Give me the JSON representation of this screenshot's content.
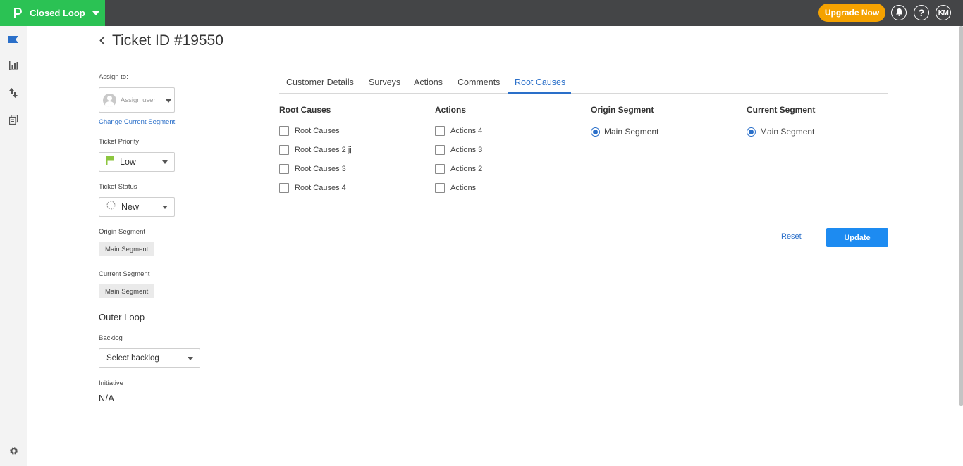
{
  "app": {
    "name": "Closed Loop"
  },
  "topbar": {
    "upgrade_label": "Upgrade Now",
    "help_label": "?",
    "user_initials": "KM"
  },
  "colors": {
    "brand": "#2bc254",
    "topbar": "#444547",
    "accent": "#2a6fc9",
    "upgrade": "#f5a200",
    "update": "#1d8bf1",
    "priority_flag": "#8dc63f"
  },
  "rail": {
    "icons": [
      "flag-icon",
      "bar-chart-icon",
      "sort-arrows-icon",
      "documents-icon",
      "gear-icon"
    ]
  },
  "page": {
    "title": "Ticket ID #19550"
  },
  "left_panel": {
    "assign_label": "Assign to:",
    "assign_placeholder": "Assign user",
    "change_segment_link": "Change Current Segment",
    "priority_label": "Ticket Priority",
    "priority_value": "Low",
    "status_label": "Ticket Status",
    "status_value": "New",
    "origin_segment_label": "Origin Segment",
    "origin_segment_value": "Main Segment",
    "current_segment_label": "Current Segment",
    "current_segment_value": "Main Segment",
    "outer_loop_heading": "Outer Loop",
    "backlog_label": "Backlog",
    "backlog_placeholder": "Select backlog",
    "initiative_label": "Initiative",
    "initiative_value": "N/A"
  },
  "tabs": [
    {
      "label": "Customer Details"
    },
    {
      "label": "Surveys"
    },
    {
      "label": "Actions"
    },
    {
      "label": "Comments"
    },
    {
      "label": "Root Causes",
      "active": true
    }
  ],
  "root_causes": {
    "heading": "Root Causes",
    "items": [
      "Root Causes",
      "Root Causes 2 jj",
      "Root Causes 3",
      "Root Causes 4"
    ]
  },
  "actions": {
    "heading": "Actions",
    "items": [
      "Actions 4",
      "Actions 3",
      "Actions 2",
      "Actions"
    ]
  },
  "origin_segment": {
    "heading": "Origin Segment",
    "option": "Main Segment",
    "selected": true
  },
  "current_segment": {
    "heading": "Current Segment",
    "option": "Main Segment",
    "selected": true
  },
  "footer": {
    "reset_label": "Reset",
    "update_label": "Update"
  }
}
